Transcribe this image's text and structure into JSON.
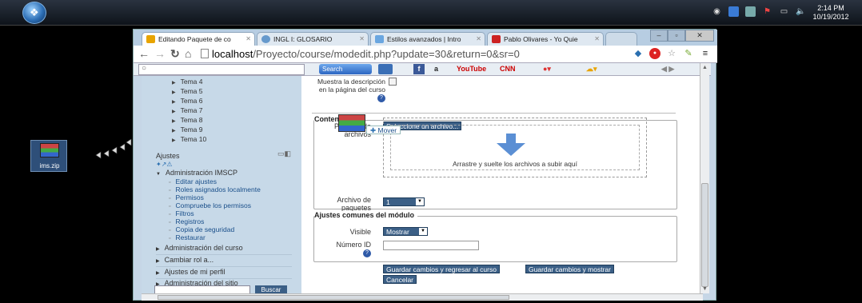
{
  "taskbar": {
    "clock_time": "2:14 PM",
    "clock_date": "10/19/2012"
  },
  "desktop": {
    "file_icon_label": "ims.zip"
  },
  "browser": {
    "tabs": [
      {
        "label": "Editando Paquete de co",
        "active": true,
        "icon_color": "#e8a400"
      },
      {
        "label": "INGL I: GLOSARIO",
        "active": false,
        "icon_color": "#6699cc"
      },
      {
        "label": "Estilos avanzados | Intro",
        "active": false,
        "icon_color": "#6aa6e0"
      },
      {
        "label": "Pablo Olivares - Yo Quie",
        "active": false,
        "icon_color": "#cc2222"
      }
    ],
    "url_host": "localhost",
    "url_path": "/Proyecto/course/modedit.php?update=30&return=0&sr=0",
    "toolbar": {
      "search_button": "Search",
      "items": [
        "a",
        "YouTube",
        "CNN"
      ]
    }
  },
  "sidebar": {
    "tree_items": [
      "Tema 4",
      "Tema 5",
      "Tema 6",
      "Tema 7",
      "Tema 8",
      "Tema 9",
      "Tema 10"
    ],
    "block_title": "Ajustes",
    "admin_heading": "Administración IMSCP",
    "admin_links": [
      "Editar ajustes",
      "Roles asignados localmente",
      "Permisos",
      "Compruebe los permisos",
      "Filtros",
      "Registros",
      "Copia de seguridad",
      "Restaurar"
    ],
    "sections": [
      "Administración del curso",
      "Cambiar rol a...",
      "Ajustes de mi perfil",
      "Administración del sitio"
    ],
    "search_button": "Buscar"
  },
  "form": {
    "show_desc_label": "Muestra la descripción en la página del curso",
    "contenido_legend": "Contenido",
    "package_label": "Paquete de archivos",
    "select_file_button": "Seleccione un archivo...",
    "mover_label": "Mover",
    "drop_text": "Arrastre y suelte los archivos a subir aquí",
    "archive_label": "Archivo de paquetes",
    "archive_value": "1",
    "common_legend": "Ajustes comunes del módulo",
    "visible_label": "Visible",
    "visible_value": "Mostrar",
    "idnumber_label": "Número ID",
    "save_return_button": "Guardar cambios y regresar al curso",
    "save_show_button": "Guardar cambios y mostrar",
    "cancel_button": "Cancelar"
  }
}
